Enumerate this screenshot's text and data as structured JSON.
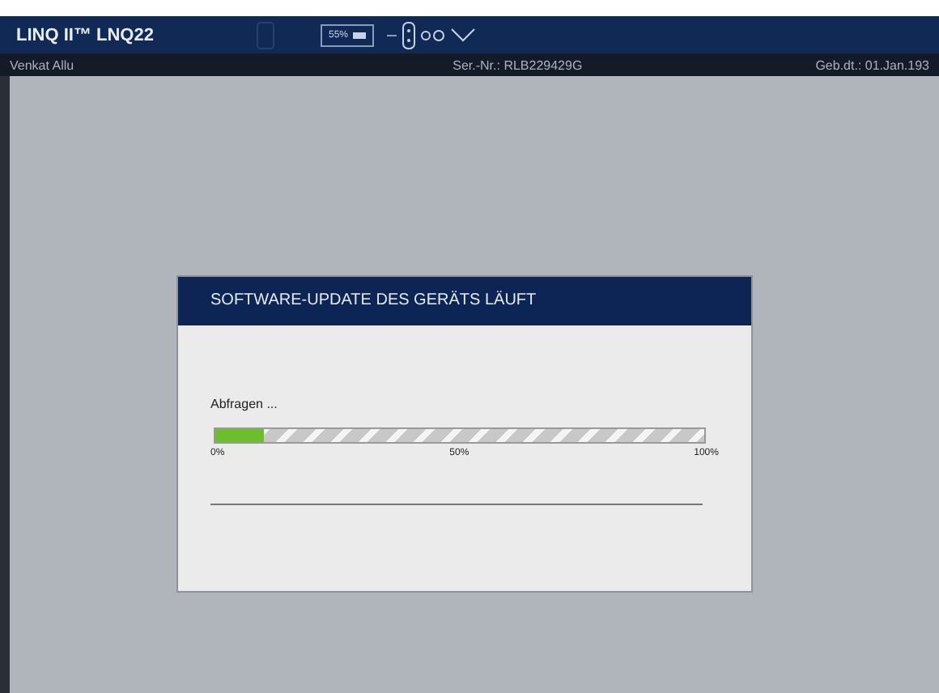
{
  "window": {
    "title": "LINQ II™ LNQ22",
    "battery": "55%"
  },
  "info_bar": {
    "user": "Venkat Allu",
    "serial": "Ser.-Nr.: RLB229429G",
    "birthdate": "Geb.dt.: 01.Jan.193"
  },
  "dialog": {
    "title": "SOFTWARE-UPDATE DES GERÄTS LÄUFT",
    "status": "Abfragen ...",
    "progress": {
      "level": 0.1,
      "ticks": [
        "0%",
        "50%",
        "100%"
      ]
    }
  }
}
